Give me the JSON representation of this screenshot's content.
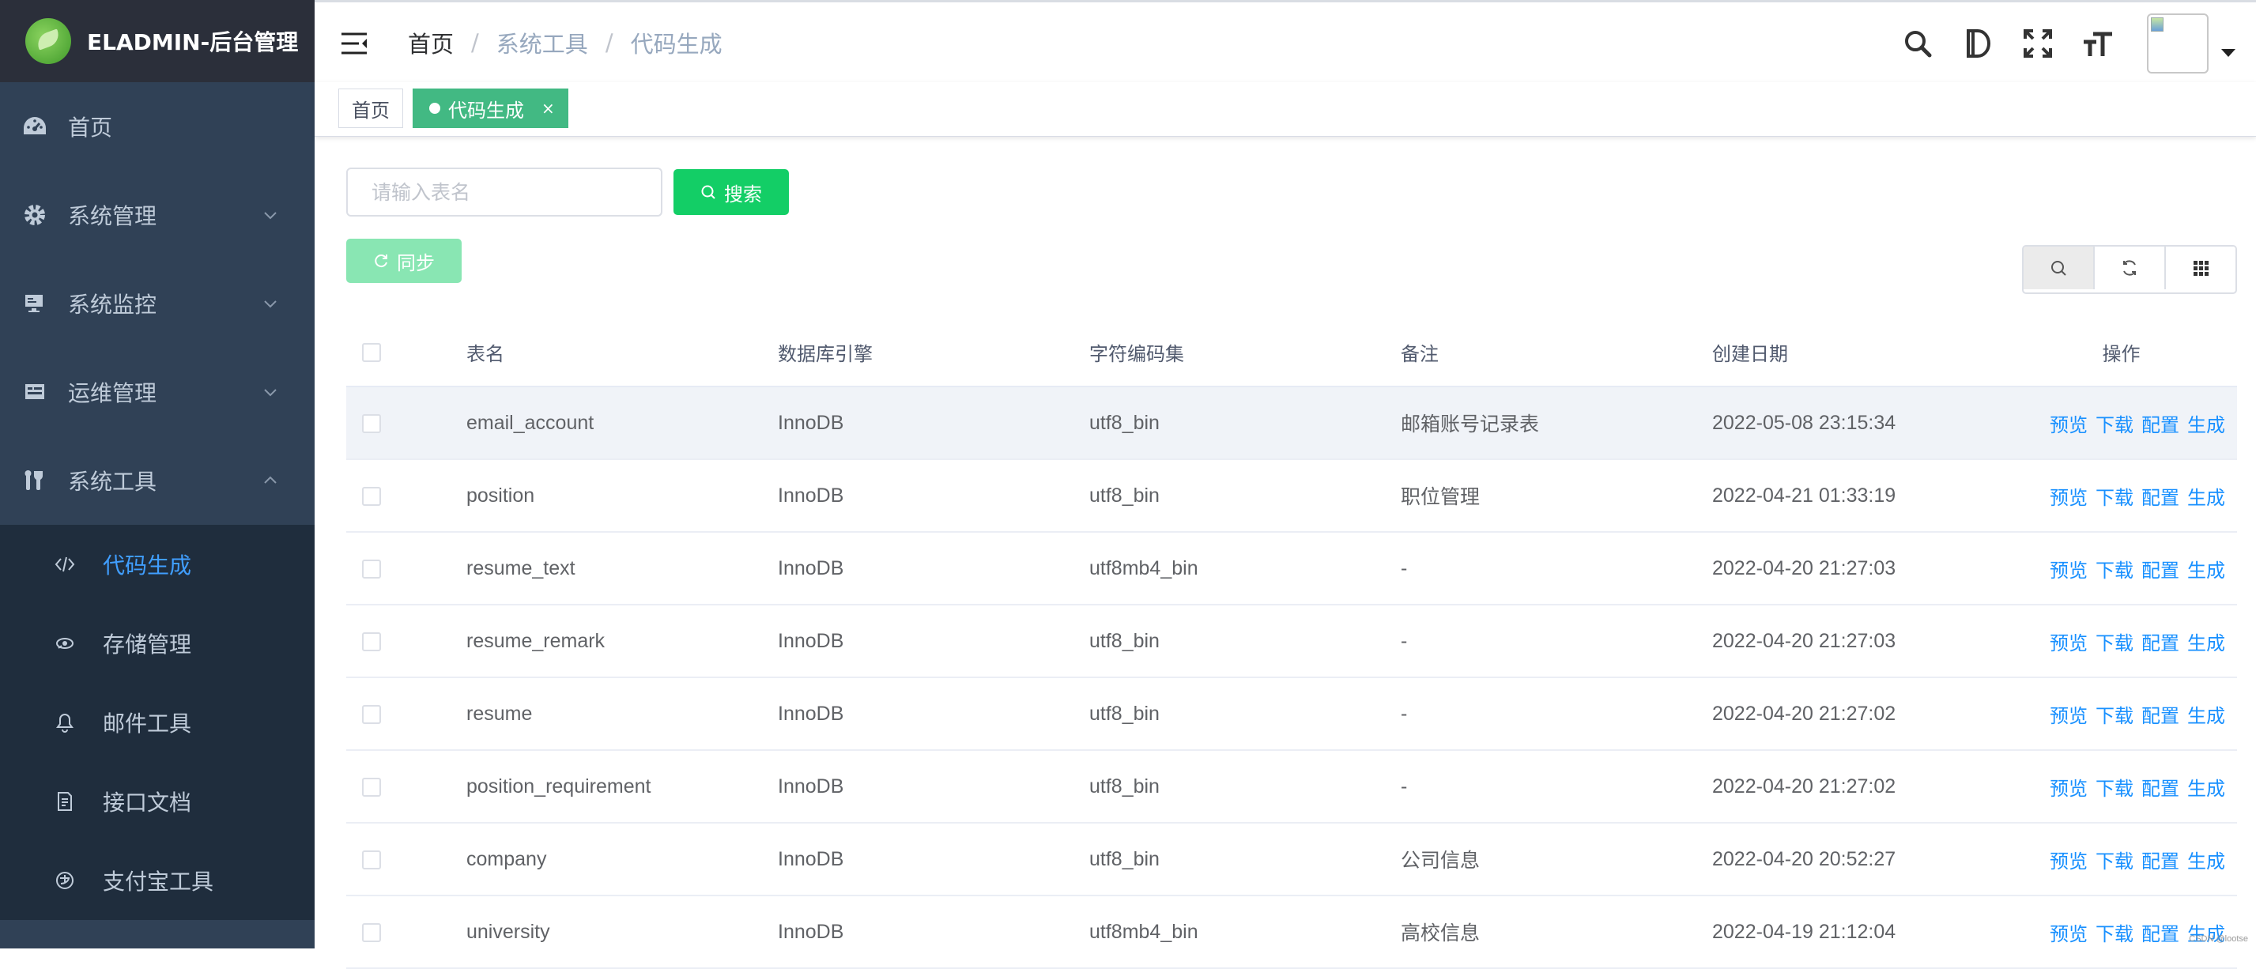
{
  "sidebar": {
    "logo_text": "ELADMIN-后台管理",
    "items": [
      {
        "label": "首页",
        "icon": "dashboard-icon"
      },
      {
        "label": "系统管理",
        "icon": "gear-icon"
      },
      {
        "label": "系统监控",
        "icon": "monitor-icon"
      },
      {
        "label": "运维管理",
        "icon": "ops-icon"
      },
      {
        "label": "系统工具",
        "icon": "tools-icon"
      }
    ],
    "submenu": [
      {
        "label": "代码生成",
        "icon": "code-icon",
        "active": true
      },
      {
        "label": "存储管理",
        "icon": "storage-icon"
      },
      {
        "label": "邮件工具",
        "icon": "bell-icon"
      },
      {
        "label": "接口文档",
        "icon": "document-icon"
      },
      {
        "label": "支付宝工具",
        "icon": "alipay-icon"
      }
    ]
  },
  "header": {
    "breadcrumb": [
      "首页",
      "系统工具",
      "代码生成"
    ],
    "breadcrumb_separator": "/"
  },
  "tags": {
    "home": "首页",
    "active": "代码生成",
    "close": "×"
  },
  "toolbar": {
    "search_placeholder": "请输入表名",
    "search_label": "搜索",
    "sync_label": "同步"
  },
  "table": {
    "columns": [
      "表名",
      "数据库引擎",
      "字符编码集",
      "备注",
      "创建日期",
      "操作"
    ],
    "actions": [
      "预览",
      "下载",
      "配置",
      "生成"
    ],
    "rows": [
      {
        "name": "email_account",
        "engine": "InnoDB",
        "charset": "utf8_bin",
        "remark": "邮箱账号记录表",
        "created": "2022-05-08 23:15:34"
      },
      {
        "name": "position",
        "engine": "InnoDB",
        "charset": "utf8_bin",
        "remark": "职位管理",
        "created": "2022-04-21 01:33:19"
      },
      {
        "name": "resume_text",
        "engine": "InnoDB",
        "charset": "utf8mb4_bin",
        "remark": "-",
        "created": "2022-04-20 21:27:03"
      },
      {
        "name": "resume_remark",
        "engine": "InnoDB",
        "charset": "utf8_bin",
        "remark": "-",
        "created": "2022-04-20 21:27:03"
      },
      {
        "name": "resume",
        "engine": "InnoDB",
        "charset": "utf8_bin",
        "remark": "-",
        "created": "2022-04-20 21:27:02"
      },
      {
        "name": "position_requirement",
        "engine": "InnoDB",
        "charset": "utf8_bin",
        "remark": "-",
        "created": "2022-04-20 21:27:02"
      },
      {
        "name": "company",
        "engine": "InnoDB",
        "charset": "utf8_bin",
        "remark": "公司信息",
        "created": "2022-04-20 20:52:27"
      },
      {
        "name": "university",
        "engine": "InnoDB",
        "charset": "utf8mb4_bin",
        "remark": "高校信息",
        "created": "2022-04-19 21:12:04"
      }
    ]
  },
  "watermark": "CSDN @lootse",
  "colors": {
    "sidebar_bg": "#304156",
    "submenu_bg": "#1f2d3d",
    "active_menu": "#409eff",
    "tag_active": "#42b983",
    "search_button": "#13ce66",
    "sync_button": "#89e6b3",
    "link": "#1890ff"
  }
}
